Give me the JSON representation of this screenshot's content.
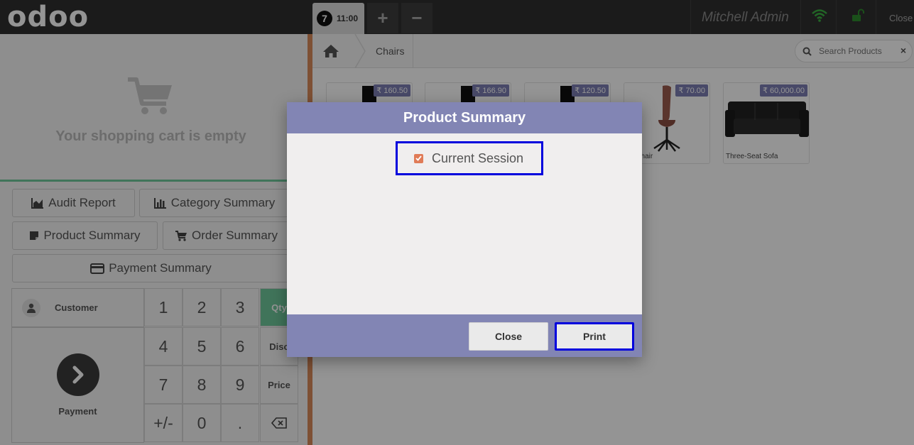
{
  "header": {
    "logo": "odoo",
    "order_number": "7",
    "order_time": "11:00",
    "add_order_symbol": "+",
    "remove_order_symbol": "−",
    "user_name": "Mitchell Admin",
    "close_label": "Close"
  },
  "cart": {
    "empty_text": "Your shopping cart is empty"
  },
  "report_buttons": {
    "audit": "Audit Report",
    "category": "Category Summary",
    "product": "Product Summary",
    "order": "Order Summary",
    "payment": "Payment Summary"
  },
  "numpad": {
    "customer": "Customer",
    "payment": "Payment",
    "keys": [
      "1",
      "2",
      "3",
      "4",
      "5",
      "6",
      "7",
      "8",
      "9",
      "+/-",
      "0",
      "."
    ],
    "modes": {
      "qty": "Qty",
      "disc": "Disc",
      "price": "Price"
    }
  },
  "breadcrumb": {
    "category": "Chairs"
  },
  "search": {
    "placeholder": "Search Products",
    "clear": "×"
  },
  "products": [
    {
      "price": "₹ 160.50",
      "name": ""
    },
    {
      "price": "₹ 166.90",
      "name": ""
    },
    {
      "price": "₹ 120.50",
      "name": ""
    },
    {
      "price": "₹ 70.00",
      "name": "ce Chair"
    },
    {
      "price": "₹ 60,000.00",
      "name": "Three-Seat Sofa"
    }
  ],
  "modal": {
    "title": "Product Summary",
    "option_label": "Current Session",
    "option_checked": true,
    "close_button": "Close",
    "print_button": "Print"
  },
  "colors": {
    "modal_accent": "#8285b4",
    "price_tag": "#7c7fb3",
    "numpad_active": "#6ec89b",
    "checkbox": "#e07b57",
    "highlight_border": "#0000dd"
  }
}
